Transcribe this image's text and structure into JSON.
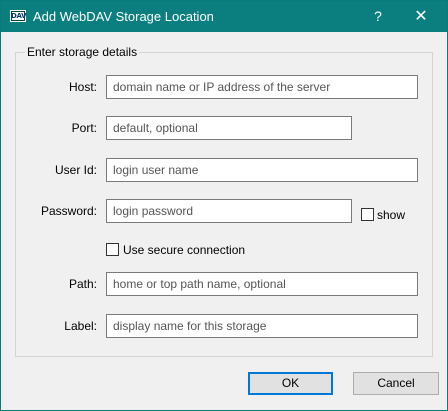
{
  "window": {
    "title": "Add WebDAV Storage Location",
    "icon_text": "DAV",
    "help": "?",
    "close": "✕"
  },
  "group": {
    "title": "Enter storage details"
  },
  "fields": {
    "host": {
      "label": "Host:",
      "placeholder": "domain name or IP address of the server"
    },
    "port": {
      "label": "Port:",
      "placeholder": "default, optional"
    },
    "user": {
      "label": "User Id:",
      "placeholder": "login user name"
    },
    "password": {
      "label": "Password:",
      "placeholder": "login password"
    },
    "path": {
      "label": "Path:",
      "placeholder": "home or top path name, optional"
    },
    "label": {
      "label": "Label:",
      "placeholder": "display name for this storage"
    }
  },
  "show_label": "show",
  "secure_label": "Use secure connection",
  "buttons": {
    "ok": "OK",
    "cancel": "Cancel"
  }
}
